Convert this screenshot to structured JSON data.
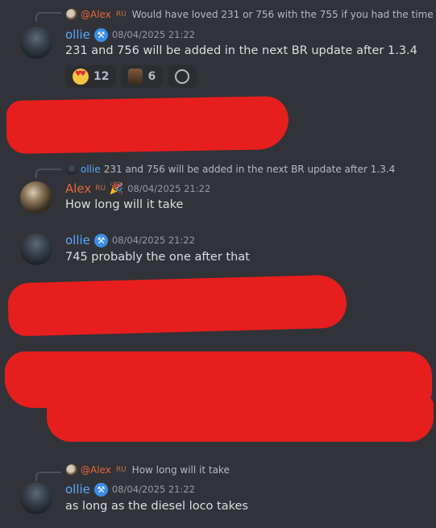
{
  "messages": [
    {
      "reply": {
        "name": "@Alex",
        "tag": "RU",
        "text": "Would have loved 231 or 756 with the 755 if you had the time"
      },
      "author": "ollie",
      "timestamp": "08/04/2025 21:22",
      "text": "231 and 756 will be added in the next BR update after 1.3.4",
      "reactions": [
        {
          "emoji": "heart-eyes",
          "count": "12"
        },
        {
          "emoji": "custom-figure",
          "count": "6"
        },
        {
          "emoji": "add-reaction",
          "count": ""
        }
      ]
    },
    {
      "reply": {
        "name": "ollie",
        "text": "231 and 756 will be added in the next BR update after 1.3.4"
      },
      "author": "Alex",
      "tag": "RU",
      "timestamp": "08/04/2025 21:22",
      "text": "How long will it take"
    },
    {
      "author": "ollie",
      "timestamp": "08/04/2025 21:22",
      "text": "745 probably the one after that"
    },
    {
      "reply": {
        "name": "@Alex",
        "tag": "RU",
        "text": "How long will it take"
      },
      "author": "ollie",
      "timestamp": "08/04/2025 21:22",
      "text": "as long as the diesel loco takes"
    }
  ],
  "colors": {
    "background": "#313338",
    "ollie": "#5aa7ff",
    "alex": "#e8663d",
    "redaction": "#e61e1e"
  }
}
